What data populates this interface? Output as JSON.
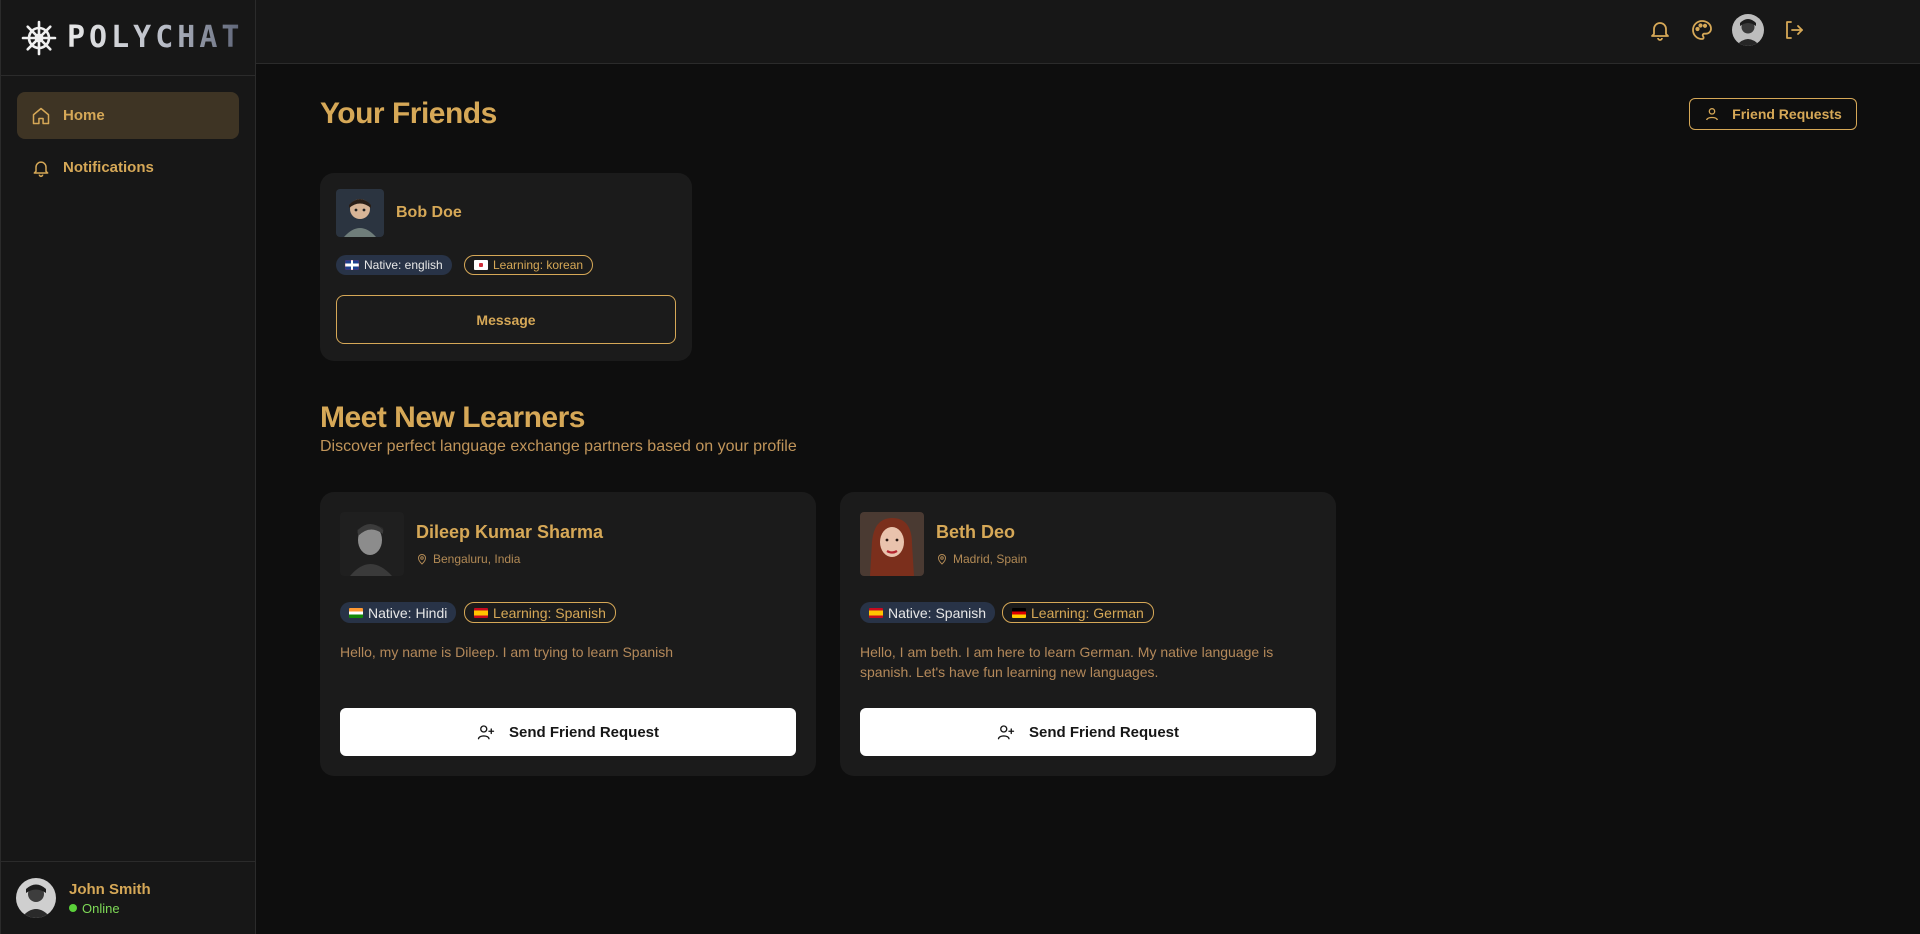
{
  "brand": {
    "name": "POLYCHAT"
  },
  "sidebar": {
    "items": [
      {
        "label": "Home",
        "icon": "home-icon",
        "active": true
      },
      {
        "label": "Notifications",
        "icon": "bell-icon",
        "active": false
      }
    ],
    "user": {
      "name": "John Smith",
      "status": "Online"
    }
  },
  "topbar": {
    "icons": [
      "bell-icon",
      "palette-icon",
      "avatar",
      "logout-icon"
    ]
  },
  "friends": {
    "title": "Your Friends",
    "requests_button": "Friend Requests",
    "cards": [
      {
        "name": "Bob Doe",
        "native": "Native: english",
        "learning": "Learning: korean",
        "action": "Message"
      }
    ]
  },
  "learners": {
    "title": "Meet New Learners",
    "subtitle": "Discover perfect language exchange partners based on your profile",
    "cards": [
      {
        "name": "Dileep Kumar Sharma",
        "location": "Bengaluru, India",
        "native": "Native: Hindi",
        "learning": "Learning: Spanish",
        "bio": "Hello, my name is Dileep. I am trying to learn Spanish",
        "action": "Send Friend Request"
      },
      {
        "name": "Beth Deo",
        "location": "Madrid, Spain",
        "native": "Native: Spanish",
        "learning": "Learning: German",
        "bio": "Hello, I am beth. I am here to learn German. My native language is spanish. Let's have fun learning new languages.",
        "action": "Send Friend Request"
      }
    ]
  },
  "colors": {
    "accent": "#d6a857",
    "background": "#0e0e0e",
    "surface": "#1b1b1b",
    "online": "#5bd13a"
  }
}
